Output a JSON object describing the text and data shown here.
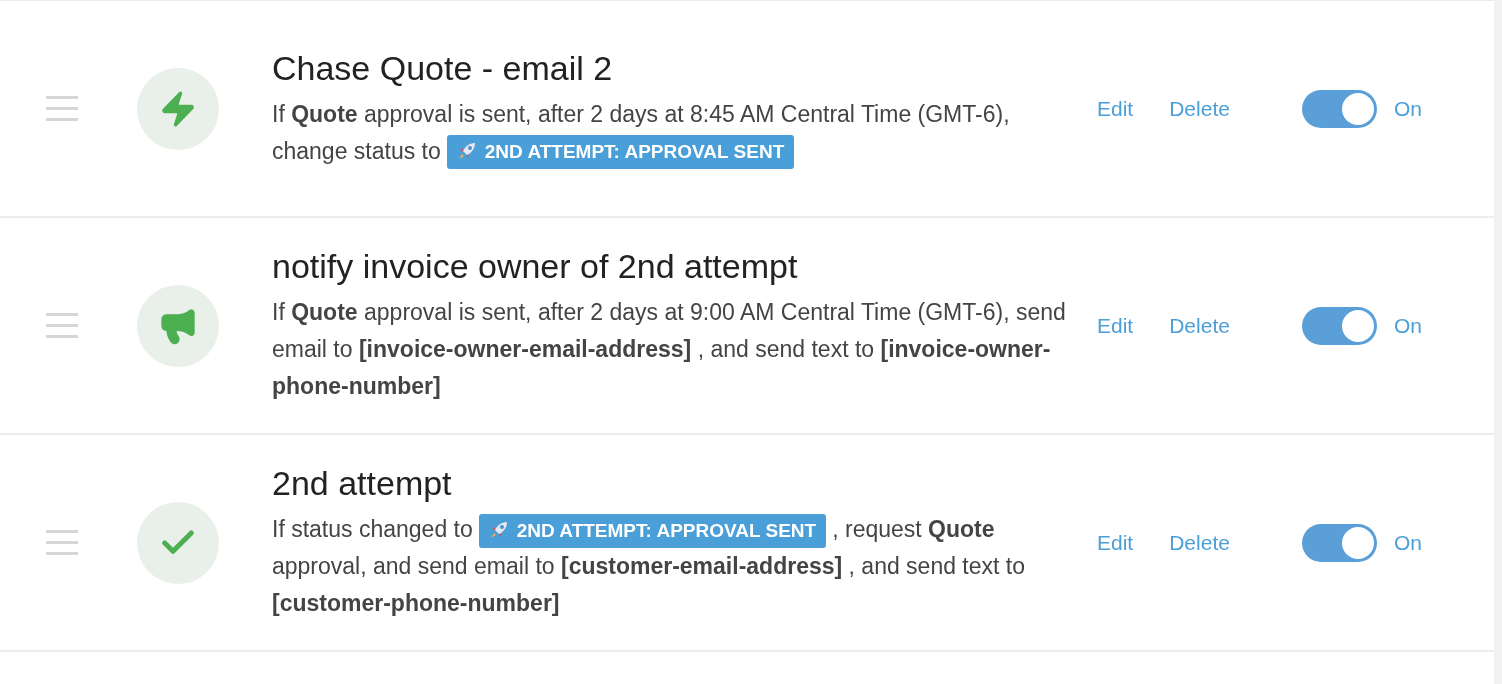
{
  "rules": [
    {
      "kind": "action",
      "title": "Chase Quote - email 2",
      "description": [
        {
          "kind": "text",
          "text": "If **Quote** approval is sent, after 2 days at 8:45 AM Central Time (GMT-6), change status to"
        },
        {
          "kind": "badge",
          "text": "2ND ATTEMPT: APPROVAL SENT"
        }
      ],
      "edit": "Edit",
      "delete": "Delete",
      "on": true,
      "toggle_label": "On"
    },
    {
      "kind": "notification",
      "title": "notify invoice owner of 2nd attempt",
      "description": [
        {
          "kind": "text",
          "text": "If **Quote** approval is sent, after 2 days at 9:00 AM Central Time (GMT-6), send email to **[invoice-owner-email-address]** , and send text to **[invoice-owner-phone-number]**"
        }
      ],
      "edit": "Edit",
      "delete": "Delete",
      "on": true,
      "toggle_label": "On"
    },
    {
      "kind": "status",
      "title": "2nd attempt",
      "description": [
        {
          "kind": "text",
          "text": "If status changed to"
        },
        {
          "kind": "badge",
          "text": "2ND ATTEMPT: APPROVAL SENT"
        },
        {
          "kind": "text",
          "text": ", request **Quote** approval, and send email to **[customer-email-address]** , and send text to **[customer-phone-number]**"
        }
      ],
      "edit": "Edit",
      "delete": "Delete",
      "on": true,
      "toggle_label": "On"
    }
  ]
}
